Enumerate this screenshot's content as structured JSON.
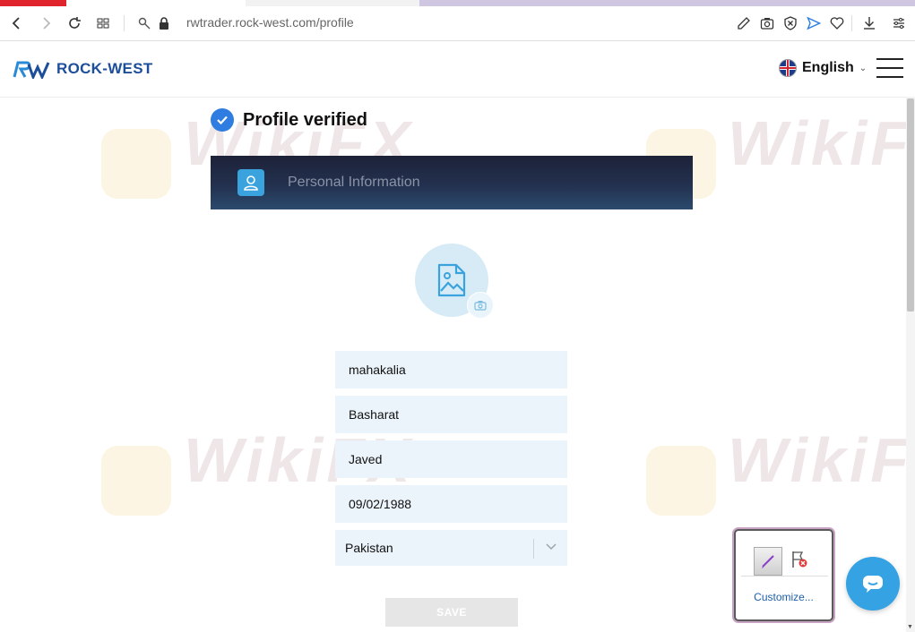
{
  "browser": {
    "url": "rwtrader.rock-west.com/profile"
  },
  "header": {
    "logo_text": "ROCK-WEST",
    "language": "English"
  },
  "watermark": {
    "text": "WikiFX"
  },
  "profile": {
    "verified_label": "Profile verified",
    "section_title": "Personal Information"
  },
  "form": {
    "first_name": "mahakalia",
    "middle_name": "Basharat",
    "last_name": "Javed",
    "birth_date": "09/02/1988",
    "country": "Pakistan",
    "save_label": "SAVE"
  },
  "popup": {
    "customize_label": "Customize..."
  },
  "colors": {
    "brand_blue": "#1d4e9a",
    "accent_blue": "#2f7de1",
    "field_bg": "#ebf4fb",
    "chat_blue": "#34a2e3"
  }
}
